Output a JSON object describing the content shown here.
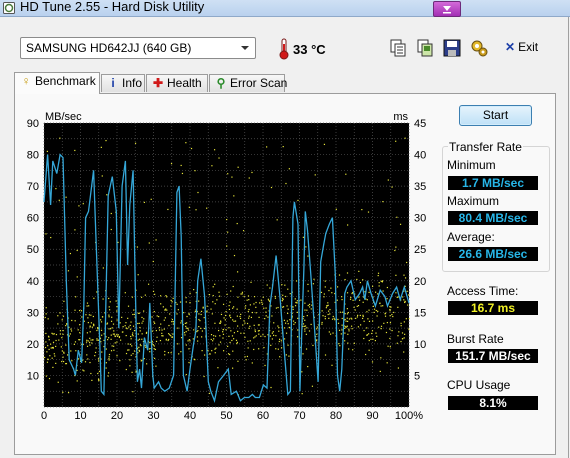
{
  "window": {
    "title": "HD Tune 2.55 - Hard Disk Utility"
  },
  "toolbar": {
    "drive": "SAMSUNG HD642JJ (640 GB)",
    "temperature": "33 °C",
    "exit_label": "Exit"
  },
  "tabs": [
    {
      "label": "Benchmark",
      "icon": "benchmark-icon",
      "active": true
    },
    {
      "label": "Info",
      "icon": "info-icon",
      "active": false
    },
    {
      "label": "Health",
      "icon": "health-icon",
      "active": false
    },
    {
      "label": "Error Scan",
      "icon": "error-scan-icon",
      "active": false
    }
  ],
  "controls": {
    "start_label": "Start"
  },
  "stats": {
    "transfer_rate_title": "Transfer Rate",
    "minimum_label": "Minimum",
    "minimum": "1.7 MB/sec",
    "maximum_label": "Maximum",
    "maximum": "80.4 MB/sec",
    "average_label": "Average:",
    "average": "26.6 MB/sec",
    "access_time_label": "Access Time:",
    "access_time": "16.7 ms",
    "burst_rate_label": "Burst Rate",
    "burst_rate": "151.7 MB/sec",
    "cpu_usage_label": "CPU Usage",
    "cpu_usage": "8.1%"
  },
  "chart_data": {
    "type": "line",
    "ylabel": "MB/sec",
    "y2label": "ms",
    "ylim": [
      0,
      90
    ],
    "y2lim": [
      0,
      45
    ],
    "xlim": [
      0,
      100
    ],
    "yticks": [
      10,
      20,
      30,
      40,
      50,
      60,
      70,
      80,
      90
    ],
    "y2ticks": [
      5,
      10,
      15,
      20,
      25,
      30,
      35,
      40,
      45
    ],
    "xticks": [
      "0",
      "10",
      "20",
      "30",
      "40",
      "50",
      "60",
      "70",
      "80",
      "90",
      "100%"
    ],
    "grid": true,
    "colors": {
      "background": "#000000",
      "grid": "#555555",
      "transfer": "#35a7d8",
      "access": "#e8e63a"
    },
    "series": [
      {
        "color": "#35a7d8",
        "x": [
          0,
          1,
          1.8,
          2.4,
          3.5,
          4.4,
          5.2,
          6.1,
          6.9,
          8.1,
          8.6,
          9.4,
          10.3,
          10.9,
          11.4,
          12.2,
          13.6,
          14.2,
          15.3,
          15.7,
          16.4,
          17.6,
          18.7,
          19.8,
          20.5,
          21.4,
          22.3,
          22.9,
          23.5,
          24.4,
          25,
          25.6,
          26.2,
          26.7,
          27.5,
          28.4,
          29,
          29.8,
          30.2,
          31.4,
          32.1,
          33.1,
          34.3,
          35.5,
          36.4,
          37,
          37.6,
          38.2,
          39.2,
          40,
          41,
          41.6,
          42.1,
          43,
          44,
          45,
          45.7,
          46.7,
          47.8,
          49.2,
          50.5,
          51.3,
          52.7,
          53.8,
          54.9,
          56.1,
          57.1,
          57.9,
          59,
          60.1,
          61.1,
          61.9,
          62.6,
          63.6,
          64.7,
          65.8,
          66.8,
          67.5,
          68.2,
          68.6,
          69.6,
          70.1,
          70.8,
          71.2,
          71.6,
          72.2,
          73.1,
          74.1,
          75.1,
          75.8,
          76.7,
          77.2,
          78.2,
          79,
          79.8,
          80.4,
          81,
          81.6,
          82.4,
          83,
          84.1,
          85.3,
          86.5,
          87.3,
          87.9,
          88.6,
          89.6,
          90.8,
          92.1,
          93.4,
          94.1,
          95.5,
          96.6,
          97.6,
          98.7,
          100
        ],
        "y": [
          65,
          80,
          64,
          78,
          74,
          80,
          79,
          40,
          15,
          12,
          10,
          18,
          14,
          32,
          60,
          62,
          75,
          55,
          20,
          5,
          4,
          67,
          73,
          62,
          25,
          70,
          78,
          45,
          64,
          75,
          38,
          8,
          12,
          6,
          22,
          18,
          33,
          10,
          6,
          8,
          6,
          5,
          6,
          10,
          68,
          70,
          54,
          10,
          5,
          12,
          20,
          24,
          40,
          47,
          35,
          8,
          5,
          2,
          8,
          10,
          12,
          4,
          5,
          2,
          3,
          3,
          4,
          3,
          3,
          7,
          6,
          32,
          38,
          48,
          34,
          18,
          4,
          5,
          60,
          65,
          58,
          5,
          30,
          44,
          62,
          56,
          42,
          25,
          8,
          46,
          52,
          55,
          58,
          60,
          42,
          10,
          5,
          12,
          36,
          38,
          40,
          34,
          36,
          38,
          34,
          40,
          36,
          32,
          37,
          35,
          32,
          36,
          38,
          34,
          38,
          33
        ]
      }
    ]
  }
}
